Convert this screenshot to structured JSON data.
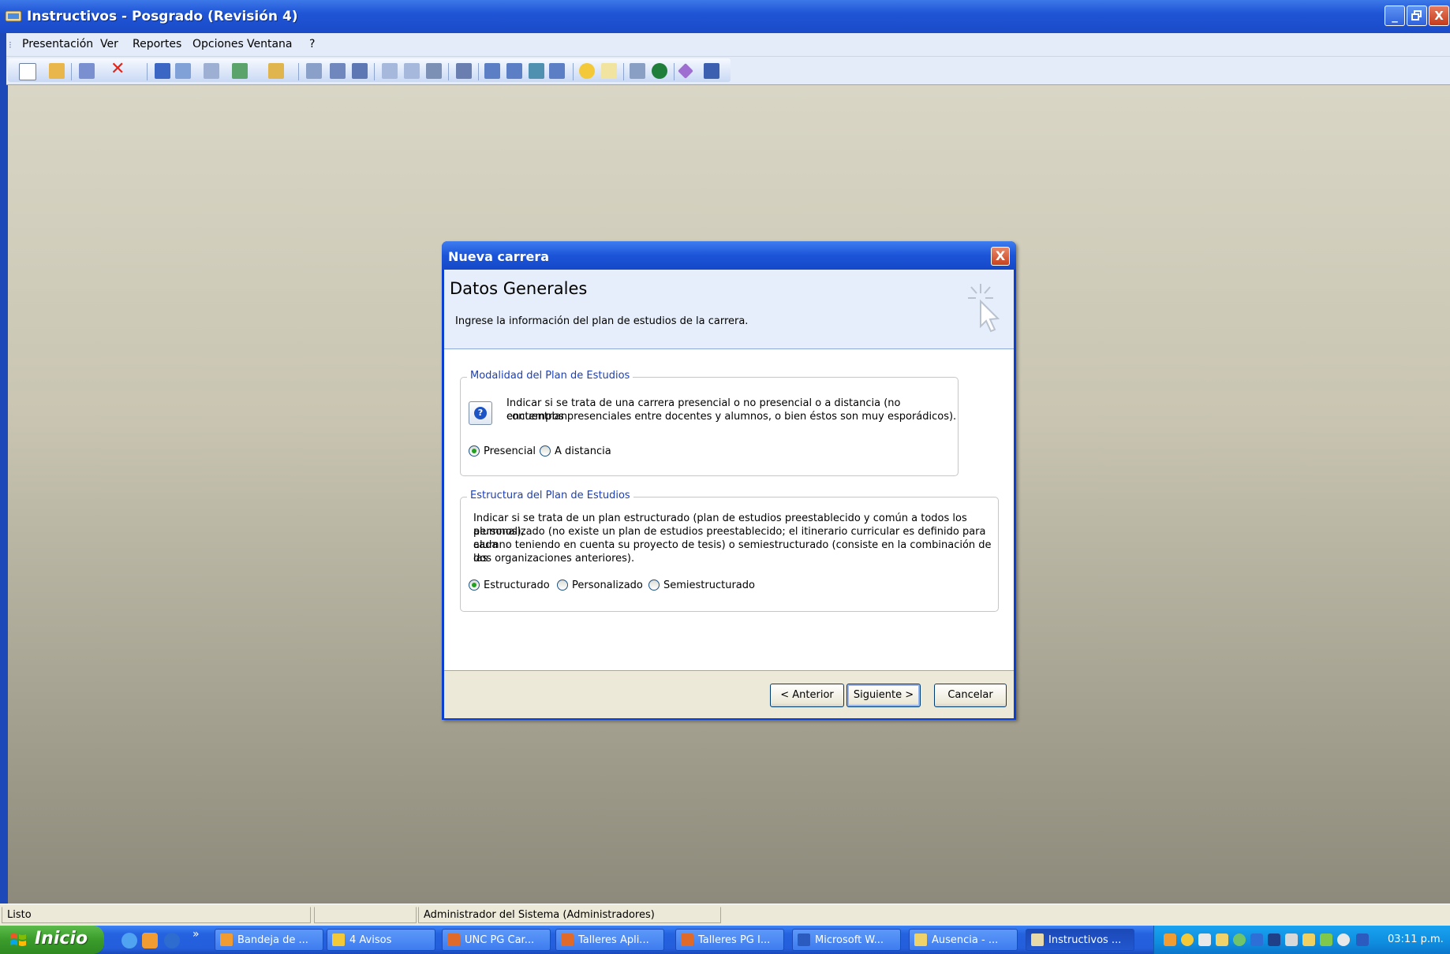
{
  "window": {
    "title": "Instructivos - Posgrado (Revisión 4)",
    "min": "_",
    "max": "❐",
    "close": "X"
  },
  "menu": [
    "Presentación",
    "Ver",
    "Reportes",
    "Opciones",
    "Ventana",
    "?"
  ],
  "status": {
    "left": "Listo",
    "middle": "",
    "user": "Administrador del Sistema (Administradores)"
  },
  "dialog": {
    "title": "Nueva carrera",
    "close": "X",
    "heading": "Datos Generales",
    "subheading": "Ingrese la información del plan de estudios de la carrera.",
    "modalidad": {
      "legend": "Modalidad del Plan de Estudios",
      "help_line1": "Indicar si se trata de una carrera presencial o no presencial o a distancia (no contemplan",
      "help_line2": "encuentros presenciales entre docentes y alumnos, o bien éstos son muy esporádicos).",
      "options": [
        "Presencial",
        "A distancia"
      ],
      "selected": "Presencial"
    },
    "estructura": {
      "legend": "Estructura del Plan de Estudios",
      "text_line1": "Indicar si se trata de un plan estructurado (plan de estudios preestablecido y común a todos los alumnos),",
      "text_line2": "personalizado (no existe un plan de estudios preestablecido; el itinerario curricular es definido para cada",
      "text_line3": "alumno teniendo en cuenta su proyecto de tesis) o semiestructurado (consiste en la combinación de las",
      "text_line4": "dos organizaciones anteriores).",
      "options": [
        "Estructurado",
        "Personalizado",
        "Semiestructurado"
      ],
      "selected": "Estructurado"
    },
    "buttons": {
      "back": "< Anterior",
      "next": "Siguiente >",
      "cancel": "Cancelar"
    }
  },
  "taskbar": {
    "start": "Inicio",
    "chevron": "»",
    "tasks": [
      "Bandeja de ...",
      "4 Avisos",
      "UNC PG Car...",
      "Talleres Apli...",
      "Talleres PG I...",
      "Microsoft W...",
      "Ausencia - ...",
      "Instructivos ..."
    ],
    "active_task": "Instructivos ...",
    "clock": "03:11 p.m."
  }
}
